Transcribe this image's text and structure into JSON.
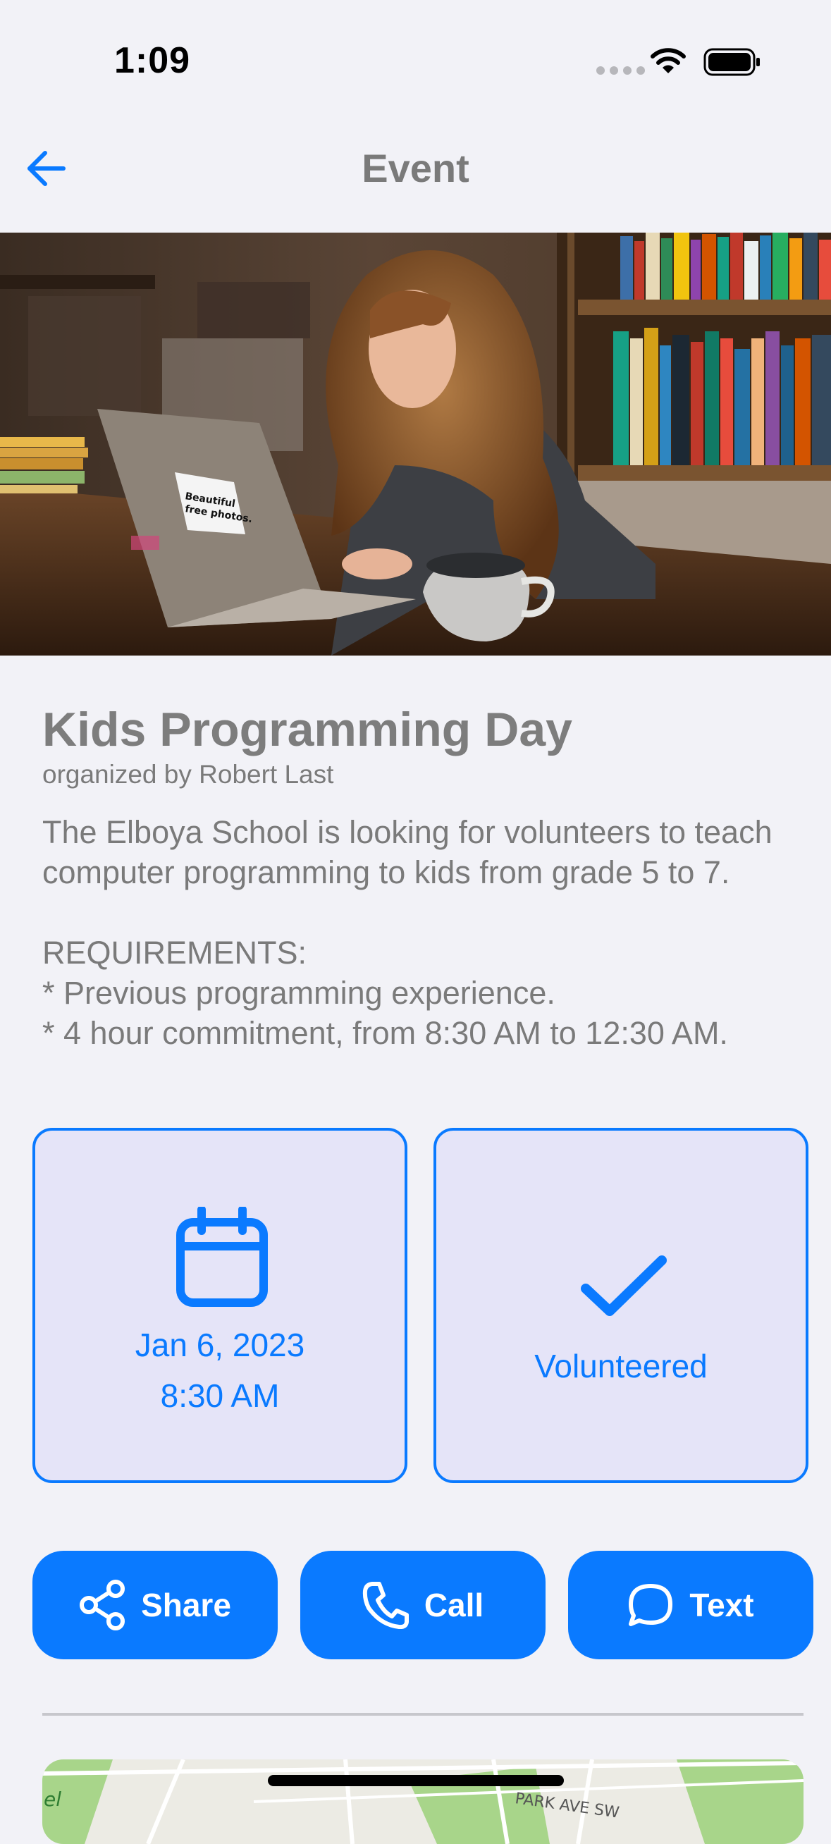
{
  "status_bar": {
    "time": "1:09"
  },
  "nav": {
    "title": "Event",
    "back_icon": "arrow-left-icon"
  },
  "event": {
    "title": "Kids Programming Day",
    "organizer": "organized by Robert Last",
    "description": "The Elboya School is looking for volunteers to teach computer programming to kids from grade 5 to 7.\n\nREQUIREMENTS:\n* Previous programming experience.\n* 4 hour commitment, from 8:30 AM to 12:30 AM.",
    "hero_sticker_text": "Beautiful free photos."
  },
  "cards": {
    "date_line1": "Jan 6, 2023",
    "date_line2": "8:30 AM",
    "volunteer_label": "Volunteered"
  },
  "actions": {
    "share_label": "Share",
    "call_label": "Call",
    "text_label": "Text"
  },
  "map": {
    "street_label": "PARK AVE SW",
    "edge_label": "el"
  },
  "colors": {
    "accent": "#0a7aff",
    "card_background": "#e5e4f8",
    "page_background": "#f2f2f7"
  }
}
